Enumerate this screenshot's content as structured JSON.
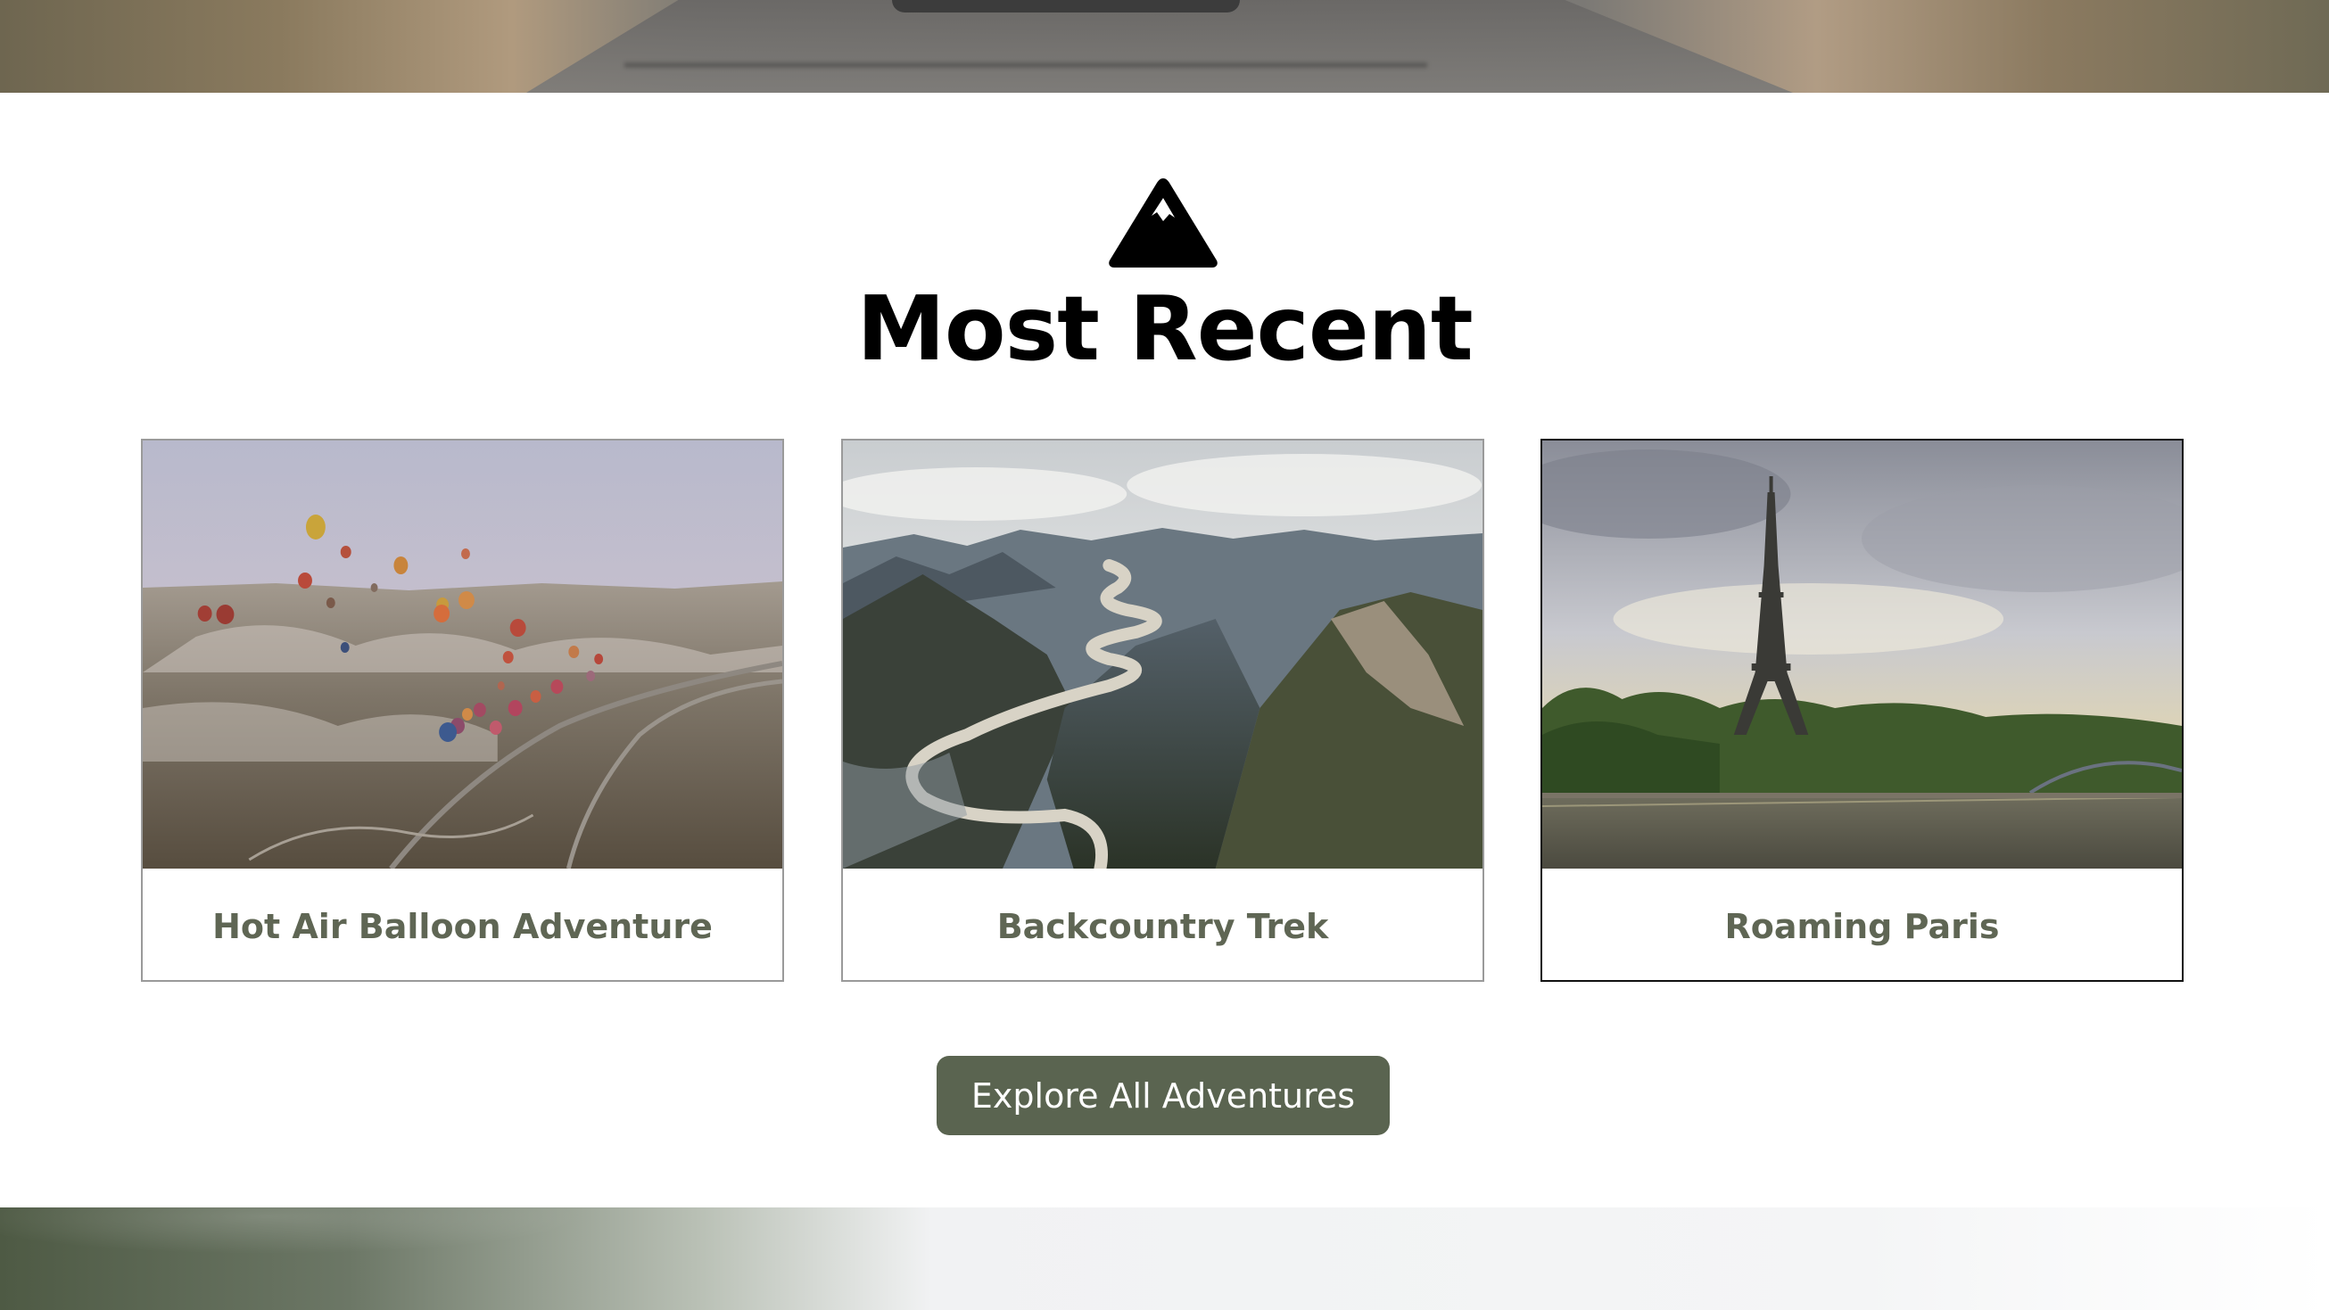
{
  "section": {
    "title": "Most Recent",
    "icon": "mountain-icon"
  },
  "cards": [
    {
      "title": "Hot Air Balloon Adventure",
      "image": "hot-air-balloons-landscape"
    },
    {
      "title": "Backcountry Trek",
      "image": "river-valley-mountains"
    },
    {
      "title": "Roaming Paris",
      "image": "eiffel-tower-seine"
    }
  ],
  "cta": {
    "label": "Explore All Adventures"
  },
  "colors": {
    "accent": "#5a6450",
    "caption_text": "#5f6654",
    "card_border": "#9a9a9a",
    "card_border_active": "#111111"
  }
}
